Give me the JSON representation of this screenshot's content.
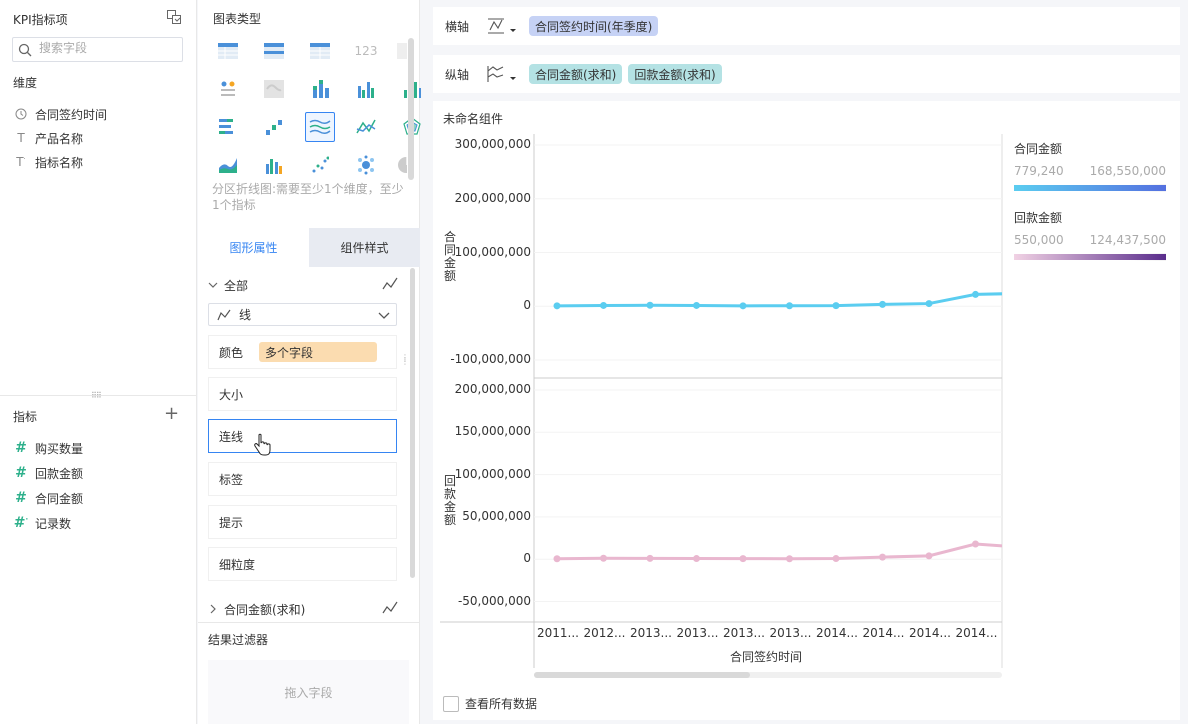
{
  "left_panel": {
    "title": "KPI指标项",
    "search_placeholder": "搜索字段",
    "dimensions_label": "维度",
    "dimensions": [
      {
        "label": "合同签约时间",
        "icon": "clock-icon"
      },
      {
        "label": "产品名称",
        "icon": "text-type-icon"
      },
      {
        "label": "指标名称",
        "icon": "text-type-icon"
      }
    ],
    "measures_label": "指标",
    "measures": [
      {
        "label": "购买数量",
        "icon": "number-type-icon"
      },
      {
        "label": "回款金额",
        "icon": "number-type-icon"
      },
      {
        "label": "合同金额",
        "icon": "number-type-icon"
      },
      {
        "label": "记录数",
        "icon": "number-type-icon"
      }
    ]
  },
  "middle_panel": {
    "chart_type_title": "图表类型",
    "chart_type_hint": "分区折线图:需要至少1个维度，至少1个指标",
    "tabs": [
      "图形属性",
      "组件样式"
    ],
    "all_label": "全部",
    "mark_type": "线",
    "color_label": "颜色",
    "color_value": "多个字段",
    "size_label": "大小",
    "connect_label": "连线",
    "label_label": "标签",
    "tooltip_label": "提示",
    "granularity_label": "细粒度",
    "sub_section": "合同金额(求和)",
    "result_filter_title": "结果过滤器",
    "drop_hint": "拖入字段"
  },
  "main": {
    "x_axis_label": "横轴",
    "x_fields": [
      "合同签约时间(年季度)"
    ],
    "y_axis_label": "纵轴",
    "y_fields": [
      "合同金额(求和)",
      "回款金额(求和)"
    ],
    "component_title": "未命名组件",
    "show_all_data": "查看所有数据"
  },
  "legend": {
    "series1_title": "合同金额",
    "series1_min": "779,240",
    "series1_max": "168,550,000",
    "series2_title": "回款金额",
    "series2_min": "550,000",
    "series2_max": "124,437,500"
  },
  "colors": {
    "accent": "#3685f2",
    "series1": "#5bcdf0",
    "series2": "#e9b7cf",
    "gradient1_start": "#5bcdf0",
    "gradient1_end": "#5470e0",
    "gradient2_start": "#f1d2e4",
    "gradient2_end": "#5a2d8c",
    "tag_color": "#fbdcb0",
    "pill_blue": "#c6d2f5",
    "pill_teal": "#b4e2e4"
  },
  "chart_data": [
    {
      "type": "line",
      "xlabel": "合同签约时间",
      "ylabel": "合同金额",
      "categories": [
        "2011...",
        "2012...",
        "2013...",
        "2013...",
        "2013...",
        "2013...",
        "2014...",
        "2014...",
        "2014...",
        "2014...",
        "2014..."
      ],
      "y_ticks": [
        "300,000,000",
        "200,000,000",
        "100,000,000",
        "0",
        "-100,000,000"
      ],
      "ylim": [
        -100000000,
        300000000
      ],
      "series": [
        {
          "name": "合同金额",
          "values": [
            800000,
            1500000,
            1800000,
            1500000,
            800000,
            900000,
            1200000,
            3500000,
            5000000,
            22000000,
            24000000
          ]
        }
      ]
    },
    {
      "type": "line",
      "xlabel": "合同签约时间",
      "ylabel": "回款金额",
      "categories": [
        "2011...",
        "2012...",
        "2013...",
        "2013...",
        "2013...",
        "2013...",
        "2014...",
        "2014...",
        "2014...",
        "2014...",
        "2014..."
      ],
      "y_ticks": [
        "200,000,000",
        "150,000,000",
        "100,000,000",
        "50,000,000",
        "0",
        "-50,000,000"
      ],
      "ylim": [
        -60000000,
        200000000
      ],
      "series": [
        {
          "name": "回款金额",
          "values": [
            600000,
            1200000,
            1000000,
            800000,
            700000,
            600000,
            800000,
            2500000,
            4000000,
            18000000,
            14000000
          ]
        }
      ]
    }
  ]
}
